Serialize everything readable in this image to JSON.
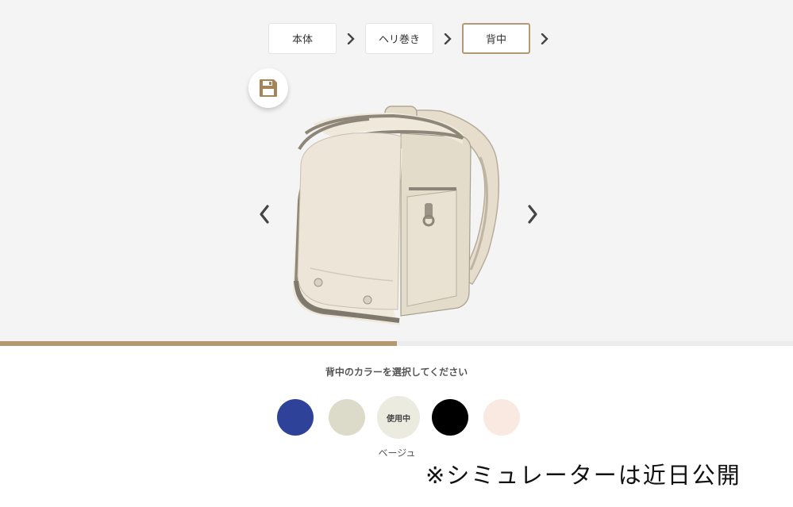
{
  "steps": [
    {
      "label": "本体",
      "active": false
    },
    {
      "label": "ヘリ巻き",
      "active": false
    },
    {
      "label": "背中",
      "active": true
    }
  ],
  "progress": 0.5,
  "prompt": "背中のカラーを選択してください",
  "swatches": [
    {
      "color": "#2f429a",
      "label": ""
    },
    {
      "color": "#dcdbc9",
      "label": ""
    },
    {
      "color": "#ecebe0",
      "label": "使用中"
    },
    {
      "color": "#000000",
      "label": ""
    },
    {
      "color": "#f9e9e1",
      "label": ""
    }
  ],
  "selected_color_name": "ベージュ",
  "notice": "※シミュレーターは近日公開",
  "icons": {
    "save": "floppy-disk-icon",
    "prev": "chevron-left-icon",
    "next": "chevron-right-icon",
    "step_arrow": "chevron-right-icon"
  },
  "colors": {
    "accent": "#b39870",
    "save_icon": "#a5845a",
    "arrow": "#444444"
  }
}
